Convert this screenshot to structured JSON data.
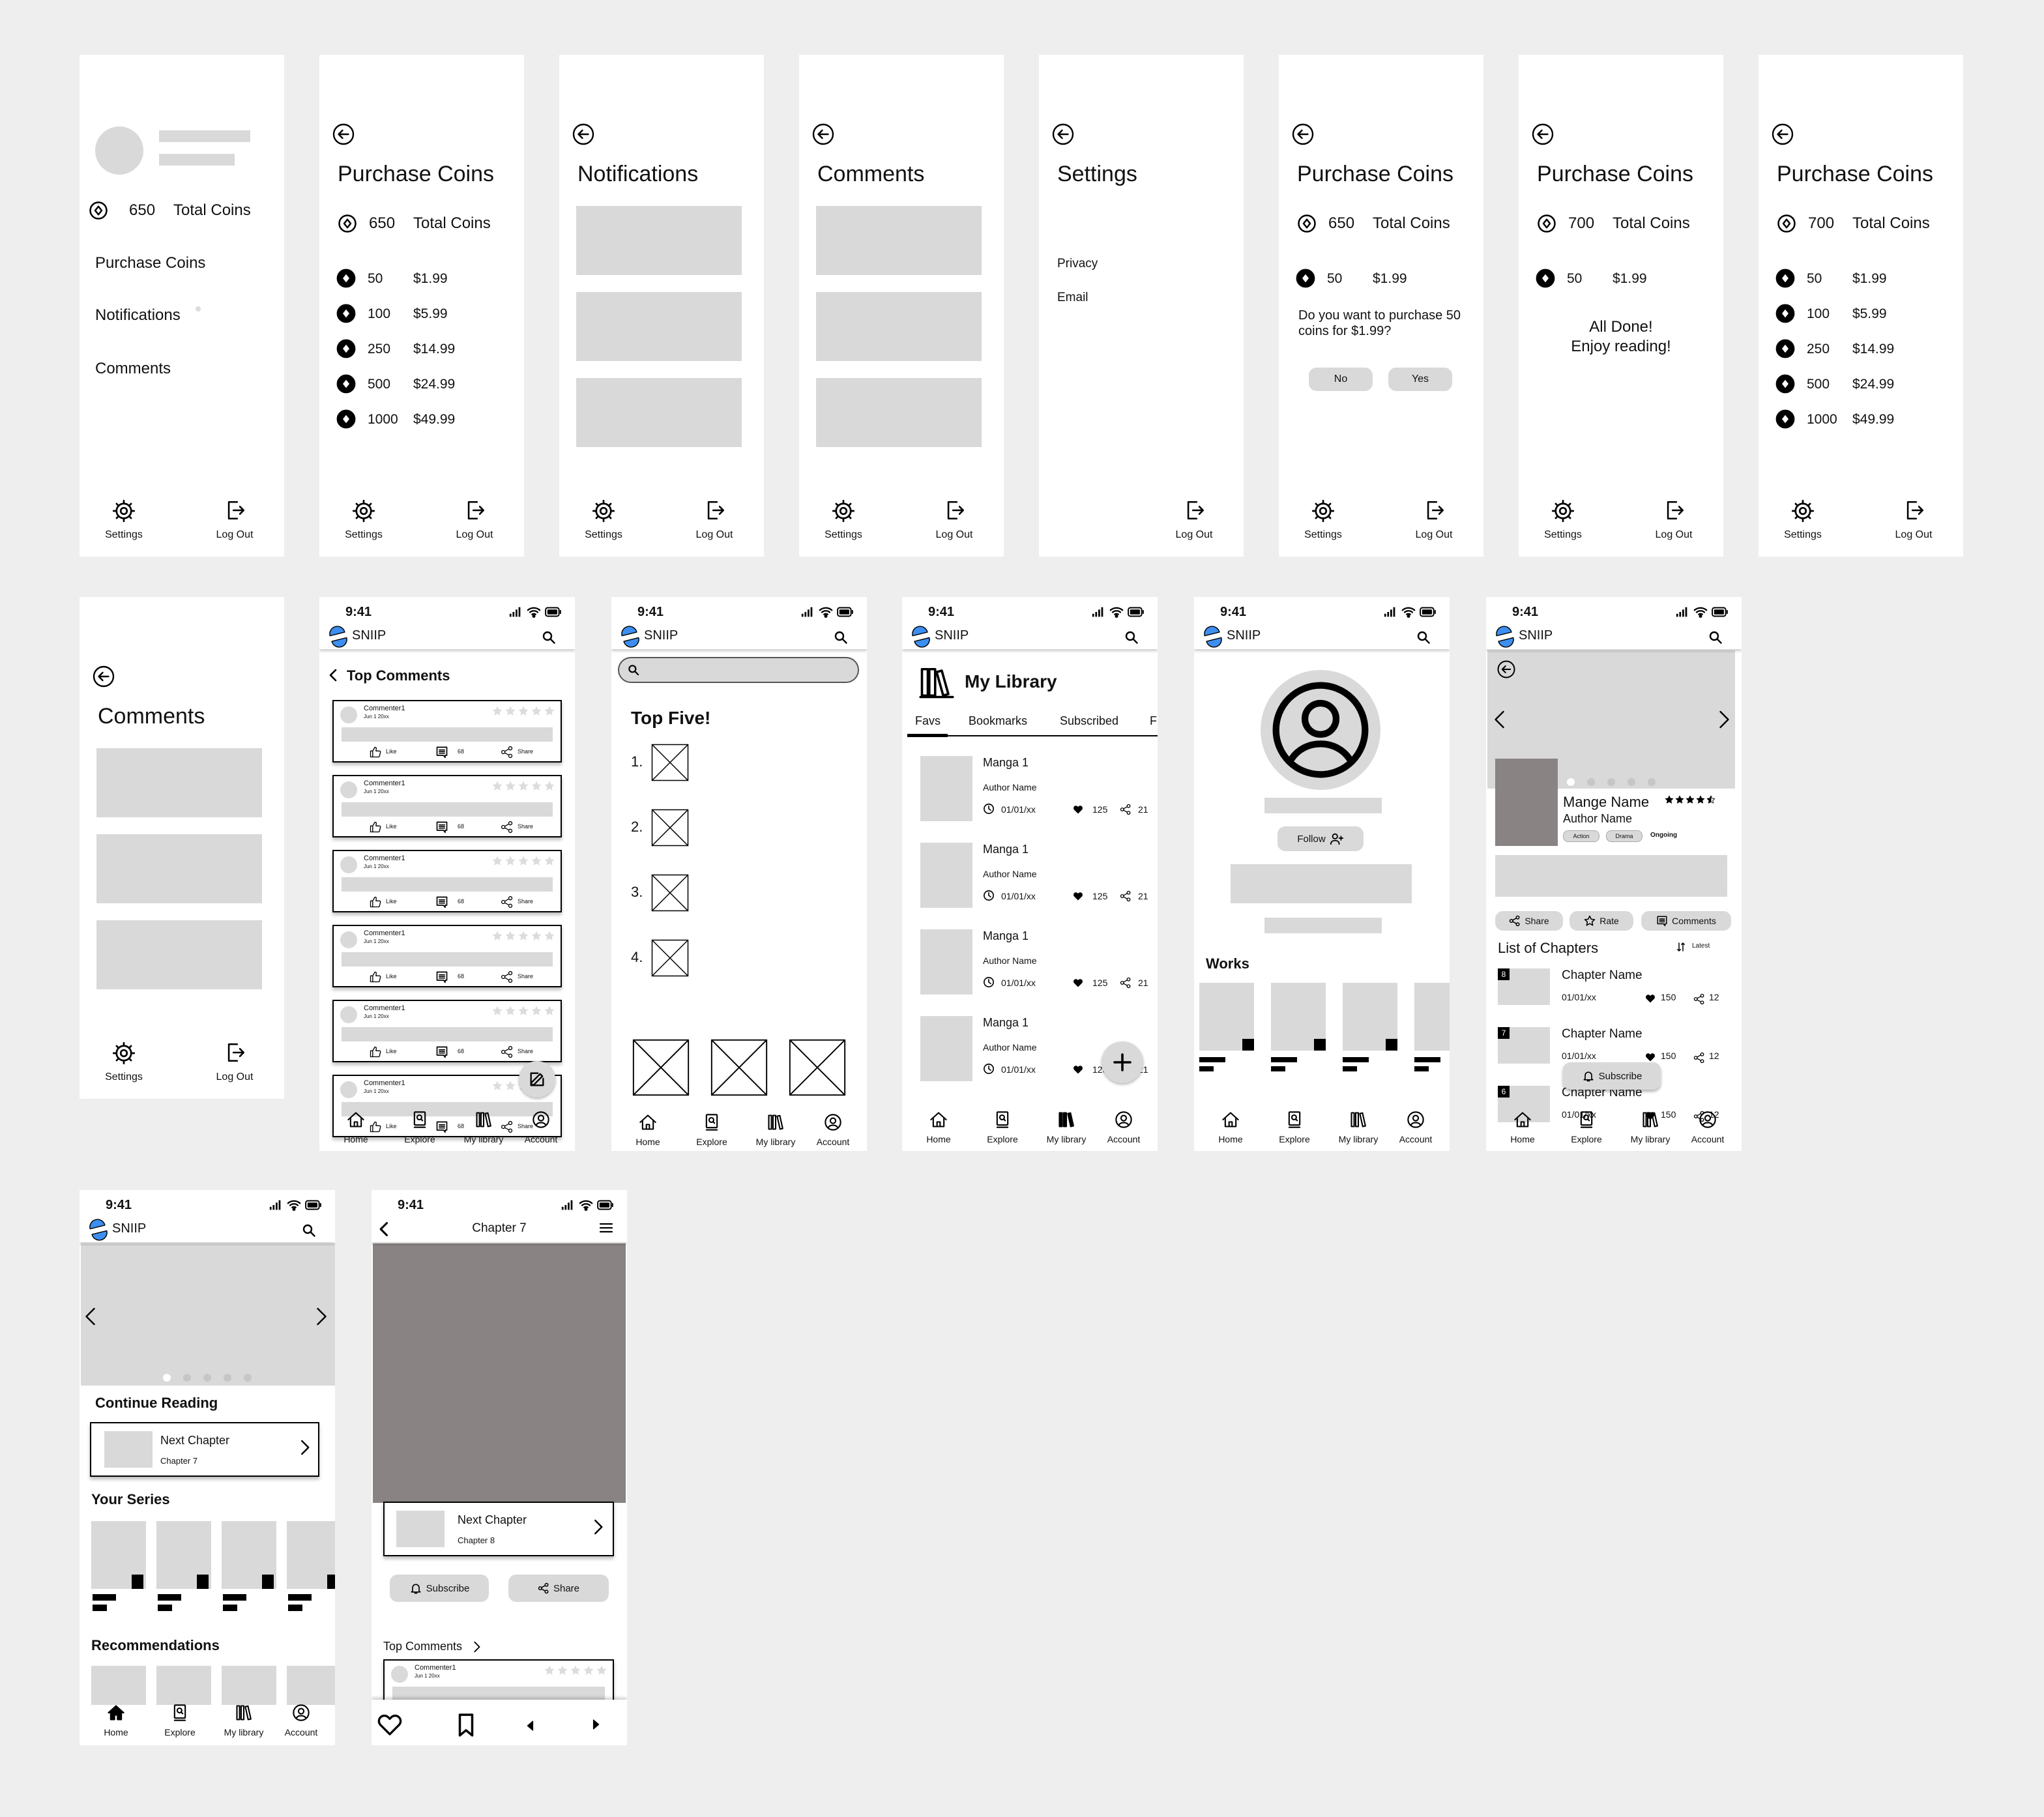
{
  "app": {
    "name": "SNIIP",
    "time": "9:41",
    "brand_color": "#3d8ef0",
    "placeholder_color": "#d9d9d9",
    "image_color": "#898383"
  },
  "footer": {
    "settings": "Settings",
    "logout": "Log Out"
  },
  "nav": [
    "Home",
    "Explore",
    "My library",
    "Account"
  ],
  "account_screens": [
    {
      "type": "menu",
      "coins": "650",
      "coins_label": "Total Coins",
      "items": [
        "Purchase Coins",
        "Notifications",
        "Comments"
      ]
    },
    {
      "type": "purchase",
      "title": "Purchase Coins",
      "coins": "650",
      "coins_label": "Total Coins",
      "packages": [
        {
          "amount": "50",
          "price": "$1.99"
        },
        {
          "amount": "100",
          "price": "$5.99"
        },
        {
          "amount": "250",
          "price": "$14.99"
        },
        {
          "amount": "500",
          "price": "$24.99"
        },
        {
          "amount": "1000",
          "price": "$49.99"
        }
      ]
    },
    {
      "type": "placeholder",
      "title": "Notifications"
    },
    {
      "type": "placeholder",
      "title": "Comments"
    },
    {
      "type": "settings",
      "title": "Settings",
      "items": [
        "Privacy",
        "Email"
      ]
    },
    {
      "type": "confirm",
      "title": "Purchase Coins",
      "coins": "650",
      "coins_label": "Total Coins",
      "packages": [
        {
          "amount": "50",
          "price": "$1.99"
        }
      ],
      "question": "Do you want to purchase 50 coins for $1.99?",
      "no": "No",
      "yes": "Yes"
    },
    {
      "type": "done",
      "title": "Purchase Coins",
      "coins": "700",
      "coins_label": "Total Coins",
      "packages": [
        {
          "amount": "50",
          "price": "$1.99"
        }
      ],
      "message": [
        "All Done!",
        "Enjoy reading!"
      ]
    },
    {
      "type": "purchase",
      "title": "Purchase Coins",
      "coins": "700",
      "coins_label": "Total Coins",
      "packages": [
        {
          "amount": "50",
          "price": "$1.99"
        },
        {
          "amount": "100",
          "price": "$5.99"
        },
        {
          "amount": "250",
          "price": "$14.99"
        },
        {
          "amount": "500",
          "price": "$24.99"
        },
        {
          "amount": "1000",
          "price": "$49.99"
        }
      ]
    },
    {
      "type": "placeholder",
      "title": "Comments"
    }
  ],
  "top_comments": {
    "title": "Top Comments",
    "comments": [
      {
        "name": "Commenter1",
        "date": "Jun 1 20xx",
        "like": "Like",
        "count": "68",
        "share": "Share"
      },
      {
        "name": "Commenter1",
        "date": "Jun 1 20xx",
        "like": "Like",
        "count": "68",
        "share": "Share"
      },
      {
        "name": "Commenter1",
        "date": "Jun 1 20xx",
        "like": "Like",
        "count": "68",
        "share": "Share"
      },
      {
        "name": "Commenter1",
        "date": "Jun 1 20xx",
        "like": "Like",
        "count": "68",
        "share": "Share"
      },
      {
        "name": "Commenter1",
        "date": "Jun 1 20xx",
        "like": "Like",
        "count": "68",
        "share": "Share"
      },
      {
        "name": "Commenter1",
        "date": "Jun 1 20xx",
        "like": "Like",
        "count": "68",
        "share": "Share"
      }
    ]
  },
  "top_five": {
    "title": "Top Five!",
    "ranks": [
      "1.",
      "2.",
      "3.",
      "4."
    ]
  },
  "library": {
    "title": "My Library",
    "tabs": [
      "Favs",
      "Bookmarks",
      "Subscribed",
      "F"
    ],
    "active_tab": "Favs",
    "items": [
      {
        "title": "Manga 1",
        "author": "Author Name",
        "date": "01/01/xx",
        "likes": "125",
        "shares": "21"
      },
      {
        "title": "Manga 1",
        "author": "Author Name",
        "date": "01/01/xx",
        "likes": "125",
        "shares": "21"
      },
      {
        "title": "Manga 1",
        "author": "Author Name",
        "date": "01/01/xx",
        "likes": "125",
        "shares": "21"
      },
      {
        "title": "Manga 1",
        "author": "Author Name",
        "date": "01/01/xx",
        "likes": "125",
        "shares": "21"
      }
    ]
  },
  "profile": {
    "follow": "Follow",
    "works_title": "Works"
  },
  "manga": {
    "name": "Mange Name",
    "author": "Author Name",
    "rating": 4.5,
    "tags": [
      "Action",
      "Drama"
    ],
    "status": "Ongoing",
    "actions": [
      "Share",
      "Rate",
      "Comments"
    ],
    "chapters_title": "List of Chapters",
    "sort": "Latest",
    "subscribe": "Subscribe",
    "chapters": [
      {
        "num": "8",
        "name": "Chapter Name",
        "date": "01/01/xx",
        "likes": "150",
        "shares": "12"
      },
      {
        "num": "7",
        "name": "Chapter Name",
        "date": "01/01/xx",
        "likes": "150",
        "shares": "12"
      },
      {
        "num": "6",
        "name": "Chapter Name",
        "date": "01/01/xx",
        "likes": "150",
        "shares": "12"
      }
    ]
  },
  "home": {
    "continue_title": "Continue Reading",
    "next": {
      "label": "Next Chapter",
      "chapter": "Chapter 7"
    },
    "series_title": "Your Series",
    "recommendations_title": "Recommendations"
  },
  "reader": {
    "title": "Chapter 7",
    "next": {
      "label": "Next Chapter",
      "chapter": "Chapter 8"
    },
    "subscribe": "Subscribe",
    "share": "Share",
    "comments_title": "Top Comments",
    "comment": {
      "name": "Commenter1",
      "date": "Jun 1 20xx"
    }
  }
}
